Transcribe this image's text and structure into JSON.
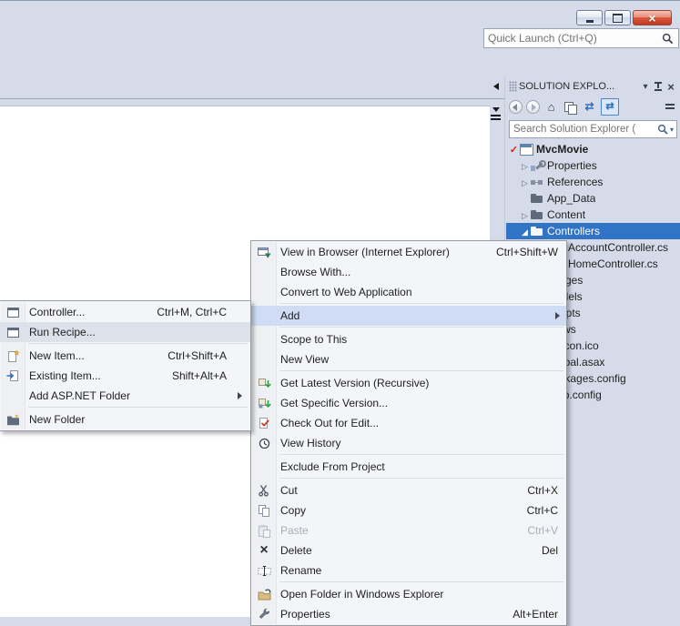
{
  "colors": {
    "selection_blue": "#3173c5",
    "menu_highlight_blue": "#cfdcf3",
    "close_button_red": "#d9553c",
    "panel_background": "#d6dbe9"
  },
  "icons": {
    "minimize-icon": "bar",
    "maximize-icon": "square",
    "close-icon": "×",
    "search-icon": "magnifier",
    "home-icon": "⌂",
    "refresh-icon": "⇄",
    "pin-icon": "pushpin",
    "chevron-collapsed-icon": "▷",
    "chevron-expanded-icon": "◢",
    "source-control-check-icon": "✓"
  },
  "quick_launch": {
    "placeholder": "Quick Launch (Ctrl+Q)"
  },
  "solution_explorer": {
    "title": "SOLUTION EXPLO...",
    "search_placeholder": "Search Solution Explorer (",
    "tree": [
      {
        "label": "MvcMovie",
        "level": 0,
        "icon": "csharp-project-icon",
        "bold": true,
        "source_control": "red-check"
      },
      {
        "label": "Properties",
        "level": 1,
        "state": "collapsed",
        "icon": "properties-icon"
      },
      {
        "label": "References",
        "level": 1,
        "state": "collapsed",
        "icon": "references-icon"
      },
      {
        "label": "App_Data",
        "level": 1,
        "icon": "folder-icon"
      },
      {
        "label": "Content",
        "level": 1,
        "state": "collapsed",
        "icon": "folder-icon"
      },
      {
        "label": "Controllers",
        "level": 1,
        "state": "expanded",
        "icon": "folder-open-icon",
        "selected": true
      },
      {
        "label": "AccountController.cs",
        "level": 2,
        "icon": "csharp-file-icon"
      },
      {
        "label": "HomeController.cs",
        "level": 2,
        "icon": "csharp-file-icon"
      },
      {
        "label": "Images",
        "level": 1,
        "state": "collapsed",
        "icon": "folder-icon"
      },
      {
        "label": "Models",
        "level": 1,
        "state": "collapsed",
        "icon": "folder-icon"
      },
      {
        "label": "Scripts",
        "level": 1,
        "state": "collapsed",
        "icon": "folder-icon"
      },
      {
        "label": "Views",
        "level": 1,
        "state": "collapsed",
        "icon": "folder-icon"
      },
      {
        "label": "favicon.ico",
        "level": 1,
        "icon": "file-icon"
      },
      {
        "label": "Global.asax",
        "level": 1,
        "state": "collapsed",
        "icon": "file-icon"
      },
      {
        "label": "packages.config",
        "level": 1,
        "icon": "file-icon"
      },
      {
        "label": "Web.config",
        "level": 1,
        "state": "collapsed",
        "icon": "file-icon"
      }
    ]
  },
  "context_menu": {
    "items": [
      {
        "label": "View in Browser (Internet Explorer)",
        "shortcut": "Ctrl+Shift+W",
        "icon": "browser-icon"
      },
      {
        "label": "Browse With..."
      },
      {
        "label": "Convert to Web Application"
      },
      {
        "label": "Add",
        "submenu": true,
        "highlighted": true
      },
      {
        "label": "Scope to This"
      },
      {
        "label": "New View"
      },
      {
        "label": "Get Latest Version (Recursive)",
        "icon": "get-latest-version-icon"
      },
      {
        "label": "Get Specific Version...",
        "icon": "get-specific-version-icon"
      },
      {
        "label": "Check Out for Edit...",
        "icon": "check-out-icon"
      },
      {
        "label": "View History",
        "icon": "history-icon"
      },
      {
        "label": "Exclude From Project"
      },
      {
        "label": "Cut",
        "shortcut": "Ctrl+X",
        "icon": "scissors-icon"
      },
      {
        "label": "Copy",
        "shortcut": "Ctrl+C",
        "icon": "copy-icon"
      },
      {
        "label": "Paste",
        "shortcut": "Ctrl+V",
        "icon": "paste-icon",
        "disabled": true
      },
      {
        "label": "Delete",
        "shortcut": "Del",
        "icon": "delete-x-icon"
      },
      {
        "label": "Rename",
        "icon": "rename-icon"
      },
      {
        "label": "Open Folder in Windows Explorer",
        "icon": "open-folder-icon"
      },
      {
        "label": "Properties",
        "shortcut": "Alt+Enter",
        "icon": "wrench-icon"
      }
    ]
  },
  "add_submenu": {
    "items": [
      {
        "label": "Controller...",
        "shortcut": "Ctrl+M, Ctrl+C",
        "icon": "window-icon"
      },
      {
        "label": "Run Recipe...",
        "icon": "window-icon",
        "hovered": true
      },
      {
        "label": "New Item...",
        "shortcut": "Ctrl+Shift+A",
        "icon": "new-item-icon"
      },
      {
        "label": "Existing Item...",
        "shortcut": "Shift+Alt+A",
        "icon": "existing-item-icon"
      },
      {
        "label": "Add ASP.NET Folder",
        "submenu": true
      },
      {
        "label": "New Folder",
        "icon": "new-folder-icon"
      }
    ]
  }
}
